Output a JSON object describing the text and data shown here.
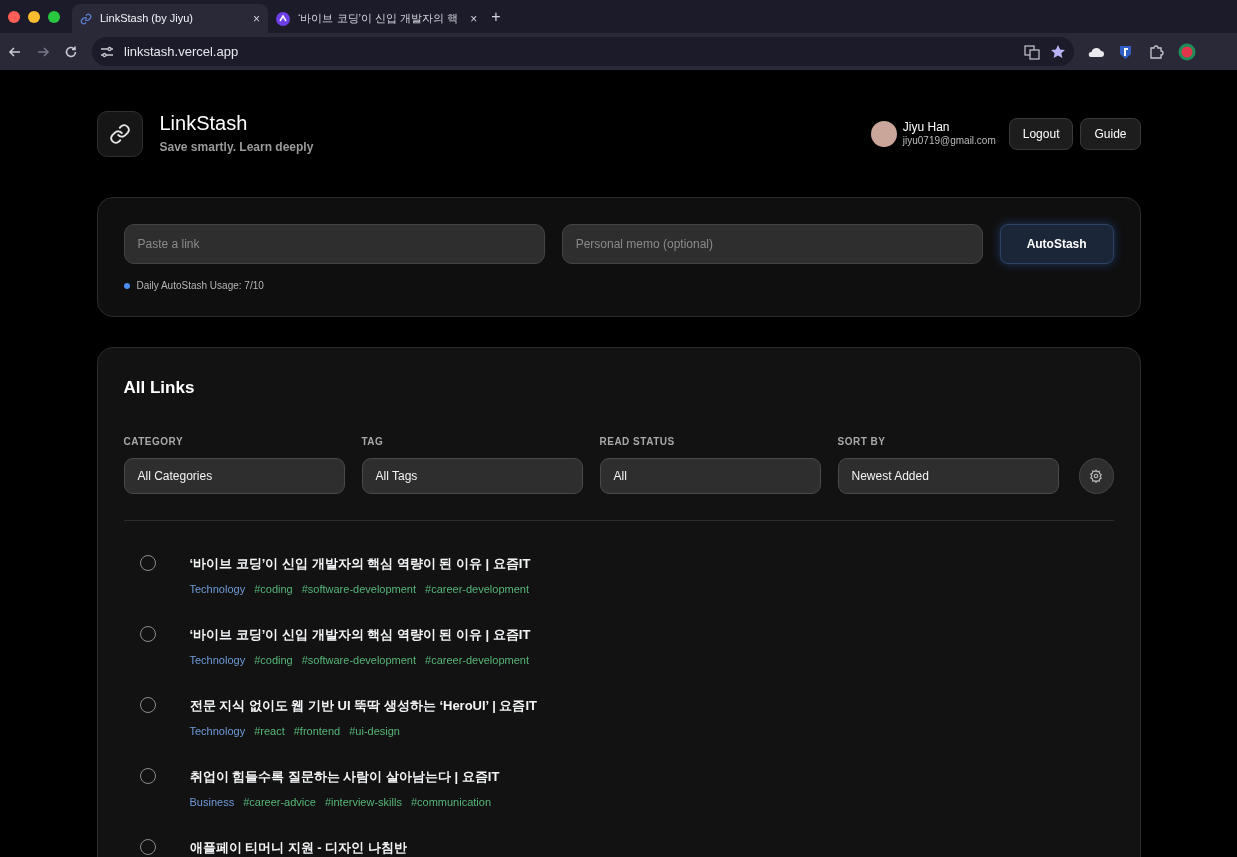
{
  "browser": {
    "tabs": [
      {
        "title": "LinkStash (by Jiyu)",
        "selected": true
      },
      {
        "title": "‘바이브 코딩’이 신입 개발자의 핵",
        "selected": false
      }
    ],
    "tab_close": "×",
    "new_tab": "+",
    "url": "linkstash.vercel.app"
  },
  "header": {
    "app_name": "LinkStash",
    "tagline": "Save smartly. Learn deeply",
    "user": {
      "name": "Jiyu Han",
      "email": "jiyu0719@gmail.com"
    },
    "buttons": [
      "Logout",
      "Guide"
    ]
  },
  "stash_form": {
    "link_field": {
      "placeholder": "Paste a link"
    },
    "memo_field": {
      "placeholder": "Personal memo (optional)"
    },
    "submit": "AutoStash",
    "usage": "Daily AutoStash Usage: 7/10"
  },
  "links_panel": {
    "title": "All Links",
    "filters": [
      {
        "label": "CATEGORY",
        "value": "All Categories"
      },
      {
        "label": "TAG",
        "value": "All Tags"
      },
      {
        "label": "READ STATUS",
        "value": "All"
      },
      {
        "label": "SORT BY",
        "value": "Newest Added"
      }
    ],
    "links": [
      {
        "title": "‘바이브 코딩’이 신입 개발자의 핵심 역량이 된 이유 | 요즘IT",
        "read": false,
        "category": "Technology",
        "tags": [
          "#coding",
          "#software-development",
          "#career-development"
        ]
      },
      {
        "title": "‘바이브 코딩’이 신입 개발자의 핵심 역량이 된 이유 | 요즘IT",
        "read": false,
        "category": "Technology",
        "tags": [
          "#coding",
          "#software-development",
          "#career-development"
        ]
      },
      {
        "title": "전문 지식 없이도 웹 기반 UI 뚝딱 생성하는 ‘HeroUI’ | 요즘IT",
        "read": false,
        "category": "Technology",
        "tags": [
          "#react",
          "#frontend",
          "#ui-design"
        ]
      },
      {
        "title": "취업이 힘들수록 질문하는 사람이 살아남는다 | 요즘IT",
        "read": false,
        "category": "Business",
        "tags": [
          "#career-advice",
          "#interview-skills",
          "#communication"
        ]
      },
      {
        "title": "애플페이 티머니 지원 - 디자인 나침반",
        "read": false
      }
    ]
  }
}
